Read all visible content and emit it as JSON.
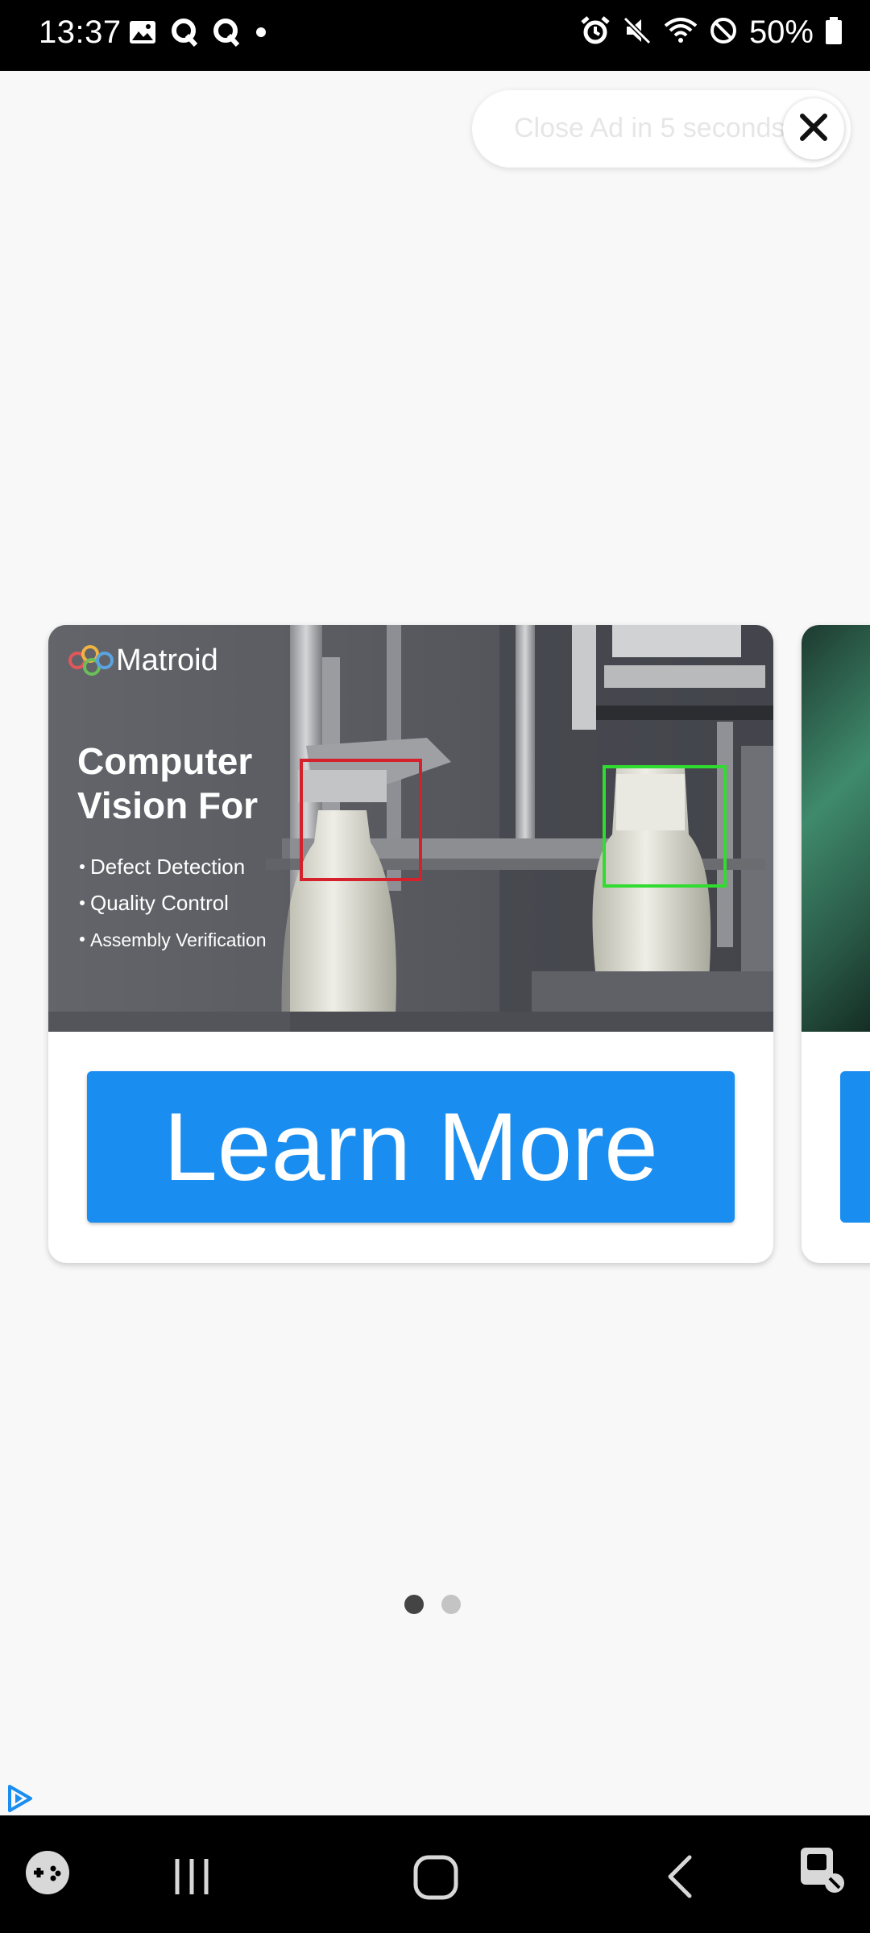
{
  "status_bar": {
    "time": "13:37",
    "left_icons": [
      "gallery-icon",
      "q-app-icon",
      "q-app-icon",
      "dot-icon"
    ],
    "right_icons": [
      "alarm-icon",
      "mute-icon",
      "wifi-icon",
      "do-not-disturb-icon"
    ],
    "battery_percent": "50%"
  },
  "dialog": {
    "pill_text": "Close Ad in 5 seconds",
    "close_icon": "close-icon"
  },
  "ad_card": {
    "brand": "Matroid",
    "headline_line1": "Computer",
    "headline_line2": "Vision For",
    "bullets": [
      "Defect Detection",
      "Quality Control",
      "Assembly Verification"
    ],
    "cta_label": "Learn More"
  },
  "pager": {
    "count": 2,
    "active_index": 0,
    "active_color": "#444444",
    "inactive_color": "#c4c4c4"
  },
  "nav_bar": {
    "items": [
      "game-launcher-icon",
      "recents-icon",
      "home-icon",
      "back-icon",
      "accessibility-icon"
    ]
  },
  "colors": {
    "cta": "#1a8ef0",
    "background": "#f8f8f8"
  }
}
